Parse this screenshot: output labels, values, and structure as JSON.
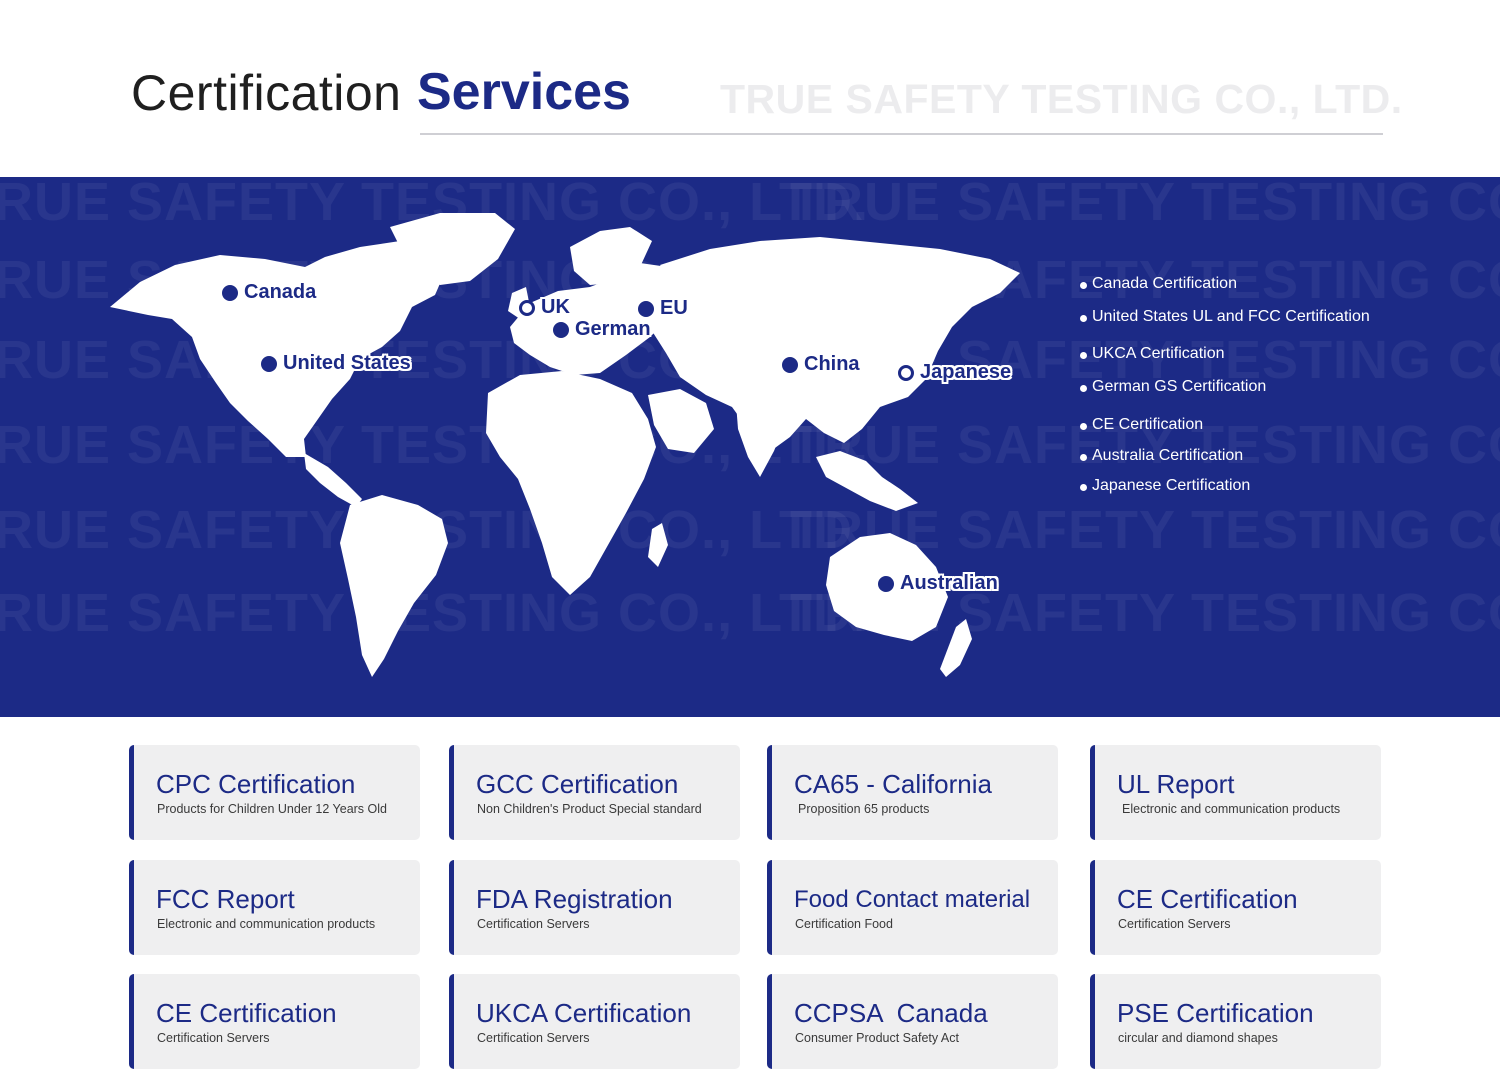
{
  "header": {
    "title_light": "Certification",
    "title_bold": "Services",
    "company_watermark": "TRUE SAFETY TESTING CO., LTD."
  },
  "map": {
    "watermark_text": "TRUE SAFETY TESTING CO., LTD.",
    "land_color": "#ffffff",
    "band_color": "#1c2a86",
    "pins": [
      {
        "label": "Canada",
        "style": "dot"
      },
      {
        "label": "United States",
        "style": "dot"
      },
      {
        "label": "UK",
        "style": "ring"
      },
      {
        "label": "EU",
        "style": "dot"
      },
      {
        "label": "German",
        "style": "dot"
      },
      {
        "label": "China",
        "style": "dot"
      },
      {
        "label": "Japanese",
        "style": "ring"
      },
      {
        "label": "Australian",
        "style": "dot"
      }
    ]
  },
  "cert_list": [
    "Canada Certification",
    "United States UL and FCC Certification",
    "UKCA Certification",
    "German GS Certification",
    "CE Certification",
    "Australia Certification",
    "Japanese Certification"
  ],
  "cards": [
    {
      "title": "CPC Certification",
      "subtitle": "Products for Children Under 12 Years Old"
    },
    {
      "title": "GCC Certification",
      "subtitle": "Non Children's Product Special standard"
    },
    {
      "title": "CA65 - California",
      "subtitle": "Proposition 65 products"
    },
    {
      "title": "UL Report",
      "subtitle": "Electronic and communication products"
    },
    {
      "title": "FCC Report",
      "subtitle": "Electronic and communication products"
    },
    {
      "title": "FDA Registration",
      "subtitle": "Certification Servers"
    },
    {
      "title": "Food Contact material",
      "subtitle": "Certification Food"
    },
    {
      "title": "CE Certification",
      "subtitle": "Certification Servers"
    },
    {
      "title": "CE Certification",
      "subtitle": "Certification Servers"
    },
    {
      "title": "UKCA Certification",
      "subtitle": "Certification Servers"
    },
    {
      "title": "CCPSA  Canada",
      "subtitle": "Consumer Product Safety Act"
    },
    {
      "title": "PSE Certification",
      "subtitle": "circular and diamond shapes"
    }
  ],
  "colors": {
    "accent": "#1c2a86",
    "card_bg": "#efeff0"
  }
}
